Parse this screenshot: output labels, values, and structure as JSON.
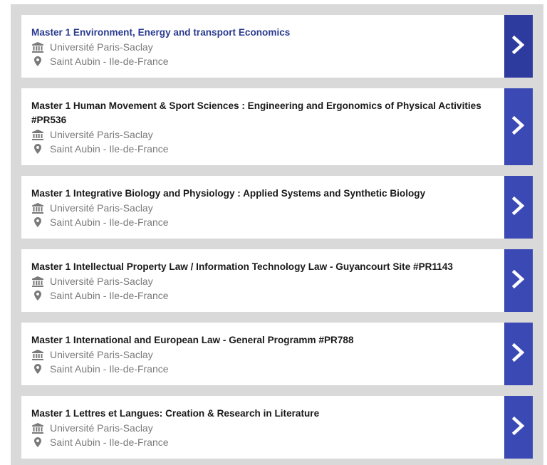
{
  "accent_color": "#3a49b4",
  "programs": [
    {
      "title": "Master 1 Environment, Energy and transport Economics",
      "university": "Université Paris-Saclay",
      "location": "Saint Aubin - Ile-de-France",
      "icons": {
        "university": "institution-icon",
        "location": "map-pin-icon",
        "action": "chevron-right-icon"
      }
    },
    {
      "title": "Master 1 Human Movement & Sport Sciences : Engineering and Ergonomics of Physical Activities #PR536",
      "university": "Université Paris-Saclay",
      "location": "Saint Aubin - Ile-de-France",
      "icons": {
        "university": "institution-icon",
        "location": "map-pin-icon",
        "action": "chevron-right-icon"
      }
    },
    {
      "title": "Master 1 Integrative Biology and Physiology : Applied Systems and Synthetic Biology",
      "university": "Université Paris-Saclay",
      "location": "Saint Aubin - Ile-de-France",
      "icons": {
        "university": "institution-icon",
        "location": "map-pin-icon",
        "action": "chevron-right-icon"
      }
    },
    {
      "title": "Master 1 Intellectual Property Law / Information Technology Law - Guyancourt Site #PR1143",
      "university": "Université Paris-Saclay",
      "location": "Saint Aubin - Ile-de-France",
      "icons": {
        "university": "institution-icon",
        "location": "map-pin-icon",
        "action": "chevron-right-icon"
      }
    },
    {
      "title": "Master 1 International and European Law - General Programm #PR788",
      "university": "Université Paris-Saclay",
      "location": "Saint Aubin - Ile-de-France",
      "icons": {
        "university": "institution-icon",
        "location": "map-pin-icon",
        "action": "chevron-right-icon"
      }
    },
    {
      "title": "Master 1 Lettres et Langues: Creation & Research in Literature",
      "university": "Université Paris-Saclay",
      "location": "Saint Aubin - Ile-de-France",
      "icons": {
        "university": "institution-icon",
        "location": "map-pin-icon",
        "action": "chevron-right-icon"
      }
    }
  ]
}
